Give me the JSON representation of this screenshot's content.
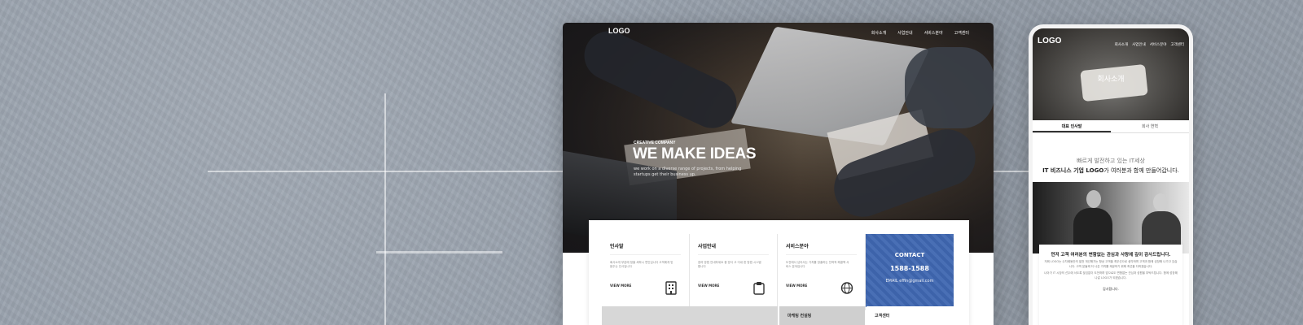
{
  "desktop": {
    "logo": "LOGO",
    "nav": [
      "회사소개",
      "사업안내",
      "서비스분야",
      "고객센터"
    ],
    "hero": {
      "eyebrow": "CREATIVE COMPANY",
      "headline": "WE MAKE IDEAS",
      "sub": "we work on a diverse range of projects, from helping startups get their business up."
    },
    "cards": [
      {
        "title": "인사말",
        "desc": "회사소개 부분에 정을 써하시 면인입니다 고객에게 믿음주는 인사입니다",
        "more": "VIEW MORE",
        "icon": "building-icon"
      },
      {
        "title": "사업안내",
        "desc": "참여 방법 안내하세요 중 방식 고 이내 한 방법 시스템 합니다",
        "more": "VIEW MORE",
        "icon": "clipboard-icon"
      },
      {
        "title": "서비스분야",
        "desc": "도전에서 넘어서는 가치를 창출하는 전략적 해결책 서비스 분야입니다",
        "more": "VIEW MORE",
        "icon": "globe-icon"
      }
    ],
    "contact": {
      "title": "CONTACT",
      "tel": "1588-1588",
      "email": "EMAIL  effin@gmail.com"
    },
    "bottom": [
      "",
      "마케팅 컨설팅",
      "고객센터"
    ]
  },
  "mobile": {
    "logo": "LOGO",
    "nav": [
      "회사소개",
      "사업안내",
      "서비스분야",
      "고객센터"
    ],
    "hero_title": "회사소개",
    "tabs": [
      "대표 인사말",
      "회사 연혁"
    ],
    "intro_line1": "빠르게 발전하고 있는 IT세상",
    "intro_bold": "IT 비즈니스 기업 LOGO",
    "intro_rest": "가 여러분과 함께 만들어갑니다.",
    "card": {
      "heading": "먼저 고객 여러분의 변함없는 관심과 사랑에 깊이 감사드립니다.",
      "para1": "저희 LOGO는 수차례동안의 발전 개선해가는 항상 고객을 최우선으로 생각하며 고객과 함께 성장해 나가고 있습니다. 고객 분들께 더 나은 가치를 제공하기 위해 최선을 다하겠습니다.",
      "para2": "나아가 IT 시장의 선두에 서도록 끊임없이 도전하며 앞으로도 변함없는 관심과 성원을 부탁드립니다. 함께 성장해 나갈 LOGO가 되겠습니다.",
      "sign": "감사합니다."
    }
  },
  "colors": {
    "contact_blue": "#3f67b1",
    "background": "#98a1ac"
  }
}
